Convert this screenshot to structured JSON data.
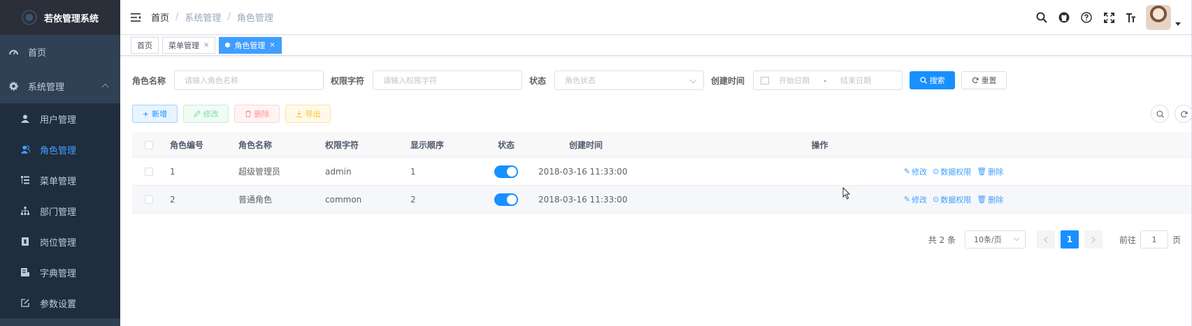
{
  "app": {
    "title": "若依管理系统"
  },
  "sidebar": {
    "items": [
      {
        "label": "首页",
        "icon": "dashboard-icon"
      },
      {
        "label": "系统管理",
        "icon": "gear-icon"
      }
    ],
    "sub_items": [
      {
        "label": "用户管理",
        "icon": "user-icon"
      },
      {
        "label": "角色管理",
        "icon": "peoples-icon"
      },
      {
        "label": "菜单管理",
        "icon": "tree-table-icon"
      },
      {
        "label": "部门管理",
        "icon": "tree-icon"
      },
      {
        "label": "岗位管理",
        "icon": "post-icon"
      },
      {
        "label": "字典管理",
        "icon": "dict-icon"
      },
      {
        "label": "参数设置",
        "icon": "edit-icon"
      }
    ],
    "active_color": "#409eff"
  },
  "breadcrumb": [
    "首页",
    "系统管理",
    "角色管理"
  ],
  "tags": [
    {
      "label": "首页"
    },
    {
      "label": "菜单管理",
      "close": "×"
    },
    {
      "label": "角色管理",
      "close": "×"
    }
  ],
  "search": {
    "role_name_label": "角色名称",
    "role_name_placeholder": "请输入角色名称",
    "role_key_label": "权限字符",
    "role_key_placeholder": "请输入权限字符",
    "status_label": "状态",
    "status_placeholder": "角色状态",
    "created_label": "创建时间",
    "start_placeholder": "开始日期",
    "range_sep": "-",
    "end_placeholder": "结束日期",
    "search_btn": "搜索",
    "reset_btn": "重置"
  },
  "toolbar": {
    "add": "新增",
    "edit": "修改",
    "delete": "删除",
    "export": "导出"
  },
  "table": {
    "headers": {
      "id": "角色编号",
      "name": "角色名称",
      "key": "权限字符",
      "sort": "显示顺序",
      "status": "状态",
      "created": "创建时间",
      "ops": "操作"
    },
    "rows": [
      {
        "id": "1",
        "name": "超级管理员",
        "key": "admin",
        "sort": "1",
        "status": true,
        "created": "2018-03-16 11:33:00"
      },
      {
        "id": "2",
        "name": "普通角色",
        "key": "common",
        "sort": "2",
        "status": true,
        "created": "2018-03-16 11:33:00"
      }
    ],
    "ops": {
      "edit": "修改",
      "data_scope": "数据权限",
      "delete": "删除"
    }
  },
  "pagination": {
    "total_text": "共 2 条",
    "page_size": "10条/页",
    "current_page": "1",
    "goto_label": "前往",
    "goto_value": "1",
    "page_suffix": "页"
  },
  "colors": {
    "sidebar_bg": "#304156",
    "primary": "#1890ff"
  }
}
